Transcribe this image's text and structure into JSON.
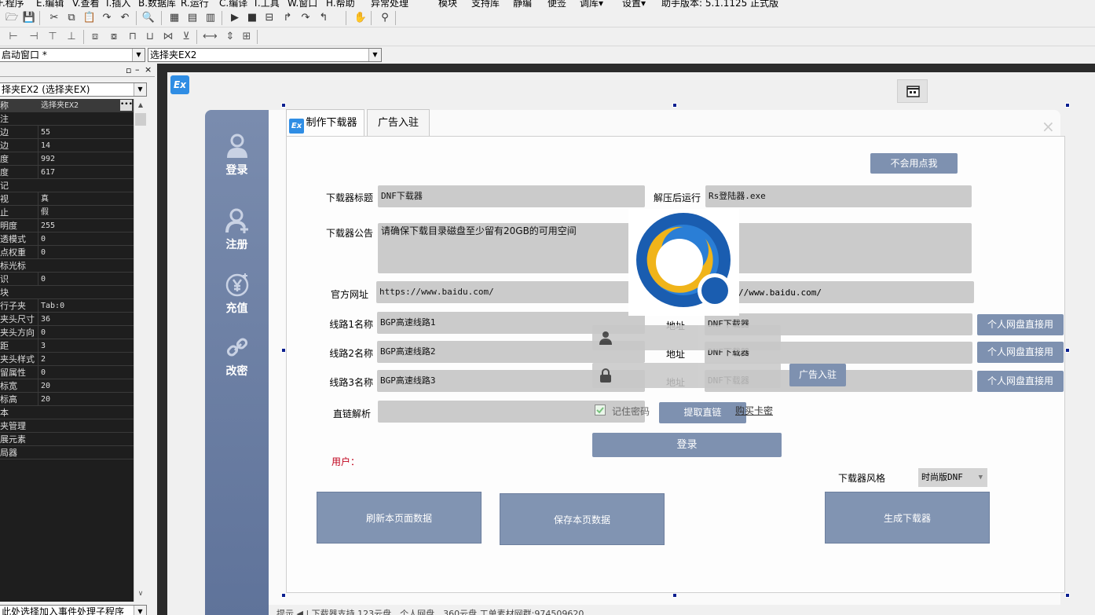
{
  "menu": [
    "F.程序",
    "E.编辑",
    "V.查看",
    "I.插入",
    "B.数据库",
    "R.运行",
    "C.编译",
    "T.工具",
    "W.窗口",
    "H.帮助",
    "异常处理",
    "模块",
    "支持库",
    "静编",
    "便签",
    "调库▾",
    "设置▾",
    "助手版本: 5.1.1125 正式版"
  ],
  "toolbar_icons": [
    "open-icon",
    "save-icon",
    "cut-icon",
    "copy-icon",
    "paste-icon",
    "redo-icon",
    "undo-icon",
    "find-icon",
    "layout1-icon",
    "layout2-icon",
    "layout3-icon",
    "run-icon",
    "stop-icon",
    "step-icon",
    "step-in-icon",
    "step-over-icon",
    "step-out-icon",
    "hand-icon",
    "binoculars-icon"
  ],
  "combos": {
    "window": "启动窗口 *",
    "control": "选择夹EX2",
    "object": "择夹EX2 (选择夹EX)",
    "event": "此处选择加入事件处理子程序"
  },
  "properties": [
    {
      "name": "称",
      "value": "选择夹EX2"
    },
    {
      "name": "注",
      "value": ""
    },
    {
      "name": "边",
      "value": "55"
    },
    {
      "name": "边",
      "value": "14"
    },
    {
      "name": "度",
      "value": "992"
    },
    {
      "name": "度",
      "value": "617"
    },
    {
      "name": "记",
      "value": ""
    },
    {
      "name": "视",
      "value": "真"
    },
    {
      "name": "止",
      "value": "假"
    },
    {
      "name": "明度",
      "value": "255"
    },
    {
      "name": "透模式",
      "value": "0"
    },
    {
      "name": "点权重",
      "value": "0"
    },
    {
      "name": "标光标",
      "value": ""
    },
    {
      "name": "识",
      "value": "0"
    },
    {
      "name": "块",
      "value": ""
    },
    {
      "name": "行子夹",
      "value": "Tab:0"
    },
    {
      "name": "夹头尺寸",
      "value": "36"
    },
    {
      "name": "夹头方向",
      "value": "0"
    },
    {
      "name": "距",
      "value": "3"
    },
    {
      "name": "夹头样式",
      "value": "2"
    },
    {
      "name": "留属性",
      "value": "0"
    },
    {
      "name": "标宽",
      "value": "20"
    },
    {
      "name": "标高",
      "value": "20"
    },
    {
      "name": "本",
      "value": ""
    },
    {
      "name": "夹管理",
      "value": ""
    },
    {
      "name": "展元素",
      "value": ""
    },
    {
      "name": "局器",
      "value": ""
    }
  ],
  "nav": [
    {
      "label": "登录",
      "icon": "user-icon"
    },
    {
      "label": "注册",
      "icon": "user-add-icon"
    },
    {
      "label": "充值",
      "icon": "yen-icon"
    },
    {
      "label": "改密",
      "icon": "link-icon"
    }
  ],
  "tabs": [
    "制作下载器",
    "广告入驻"
  ],
  "form": {
    "help_button": "不会用点我",
    "title_label": "下载器标题",
    "title_value": "DNF下载器",
    "run_label": "解压后运行",
    "run_value": "Rs登陆器.exe",
    "notice_label": "下载器公告",
    "notice_value": "请确保下载目录磁盘至少留有20GB的可用空间",
    "site_label": "官方网址",
    "site_value": "https://www.baidu.com/",
    "site_value2": "//www.baidu.com/",
    "lines": [
      {
        "label": "线路1名称",
        "value": "BGP高速线路1",
        "addr_label": "地址",
        "addr_value": "DNF下载器",
        "button": "个人网盘直接用"
      },
      {
        "label": "线路2名称",
        "value": "BGP高速线路2",
        "addr_label": "地址",
        "addr_value": "DNF下载器",
        "button": "个人网盘直接用"
      },
      {
        "label": "线路3名称",
        "value": "BGP高速线路3",
        "addr_label": "地址",
        "addr_value": "DNF下载器",
        "button": "个人网盘直接用"
      }
    ],
    "direct_label": "直链解析",
    "direct_value": "",
    "get_link_button": "提取直链",
    "remember_label": "记住密码",
    "buy_card": "购买卡密",
    "ad_button": "广告入驻",
    "login_button": "登录",
    "user_label": "用户：",
    "style_label": "下载器风格",
    "style_value": "时尚版DNF",
    "refresh_button": "刷新本页面数据",
    "save_button": "保存本页数据",
    "generate_button": "生成下载器"
  },
  "status": "提示 ◀ | 下载器支持 123云盘、个人网盘、360云盘    工单素材网群:974509620",
  "colors": {
    "accent": "#7e91b0",
    "nav": "#6b7fa3",
    "field": "#cbcbcb",
    "user_label": "#c0001a",
    "check": "#79c37e"
  }
}
